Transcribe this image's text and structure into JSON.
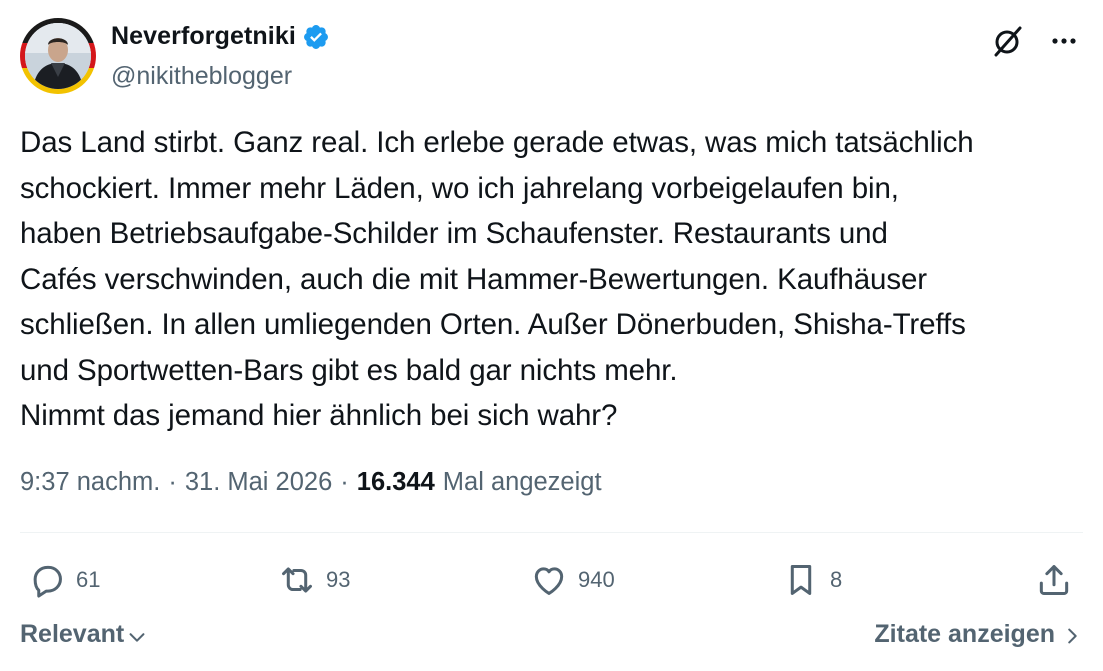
{
  "author": {
    "display_name": "Neverforgetniki",
    "handle": "@nikitheblogger",
    "verified": true,
    "avatar_icon": "profile-photo"
  },
  "header_icons": [
    "grok-icon",
    "more-icon"
  ],
  "tweet": {
    "text": "Das Land stirbt. Ganz real. Ich erlebe gerade etwas, was mich tatsächlich\nschockiert. Immer mehr Läden, wo ich jahrelang vorbeigelaufen bin,\nhaben Betriebsaufgabe-Schilder im Schaufenster. Restaurants und\nCafés verschwinden, auch die mit Hammer-Bewertungen. Kaufhäuser\nschließen. In allen umliegenden Orten. Außer Dönerbuden, Shisha-Treffs\nund Sportwetten-Bars gibt es bald gar nichts mehr.\nNimmt das jemand hier ähnlich bei sich wahr?"
  },
  "meta": {
    "time": "9:37 nachm.",
    "separator": "·",
    "date": "31. Mai 2026",
    "views": "16.344",
    "views_label": "Mal angezeigt"
  },
  "actions": {
    "replies": "61",
    "reposts": "93",
    "likes": "940",
    "bookmarks": "8"
  },
  "footer": {
    "sort_label": "Relevant",
    "quotes_label": "Zitate anzeigen"
  },
  "colors": {
    "text_primary": "#0f1419",
    "text_secondary": "#536471",
    "verified_blue": "#1d9bf0",
    "divider": "#eff3f4"
  }
}
